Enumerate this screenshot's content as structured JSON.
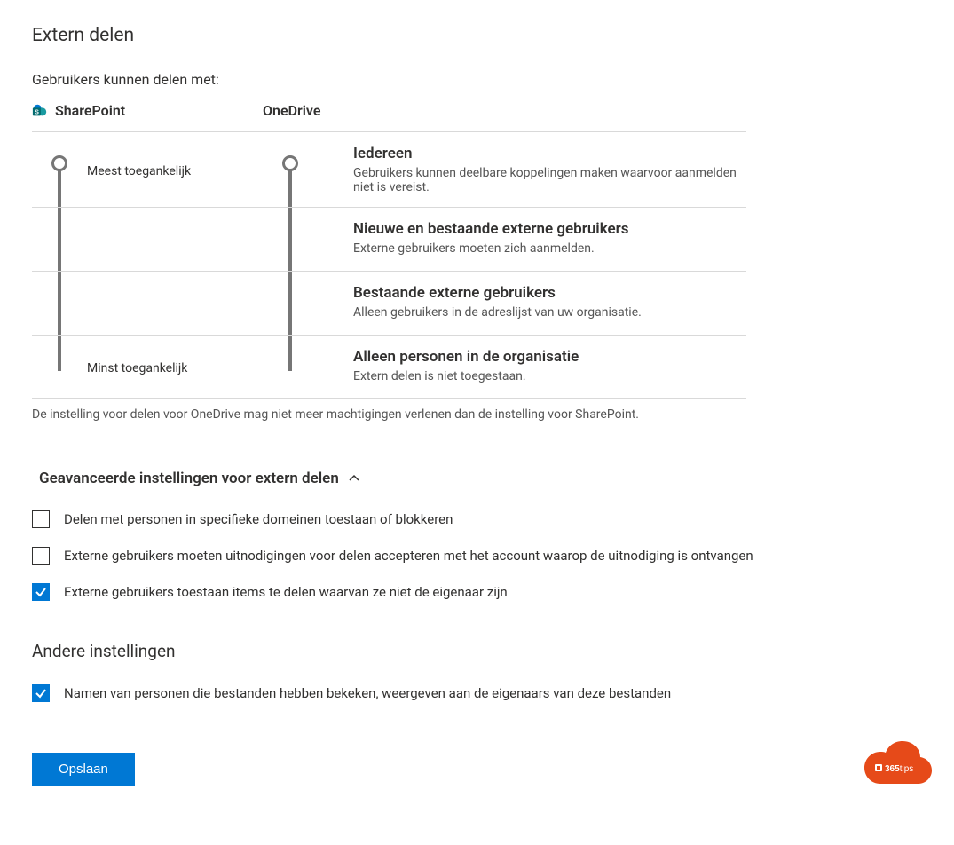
{
  "title": "Extern delen",
  "subtitle": "Gebruikers kunnen delen met:",
  "columns": {
    "sharepoint": "SharePoint",
    "onedrive": "OneDrive"
  },
  "scale": {
    "most": "Meest toegankelijk",
    "least": "Minst toegankelijk"
  },
  "options": [
    {
      "title": "Iedereen",
      "desc": "Gebruikers kunnen deelbare koppelingen maken waarvoor aanmelden niet is vereist."
    },
    {
      "title": "Nieuwe en bestaande externe gebruikers",
      "desc": "Externe gebruikers moeten zich aanmelden."
    },
    {
      "title": "Bestaande externe gebruikers",
      "desc": "Alleen gebruikers in de adreslijst van uw organisatie."
    },
    {
      "title": "Alleen personen in de organisatie",
      "desc": "Extern delen is niet toegestaan."
    }
  ],
  "footnote": "De instelling voor delen voor OneDrive mag niet meer machtigingen verlenen dan de instelling voor SharePoint.",
  "advanced": {
    "header": "Geavanceerde instellingen voor extern delen",
    "items": [
      {
        "label": "Delen met personen in specifieke domeinen toestaan of blokkeren",
        "checked": false
      },
      {
        "label": "Externe gebruikers moeten uitnodigingen voor delen accepteren met het account waarop de uitnodiging is ontvangen",
        "checked": false
      },
      {
        "label": "Externe gebruikers toestaan items te delen waarvan ze niet de eigenaar zijn",
        "checked": true
      }
    ]
  },
  "other": {
    "header": "Andere instellingen",
    "items": [
      {
        "label": "Namen van personen die bestanden hebben bekeken, weergeven aan de eigenaars van deze bestanden",
        "checked": true
      }
    ]
  },
  "save": "Opslaan",
  "watermark": "365tips"
}
